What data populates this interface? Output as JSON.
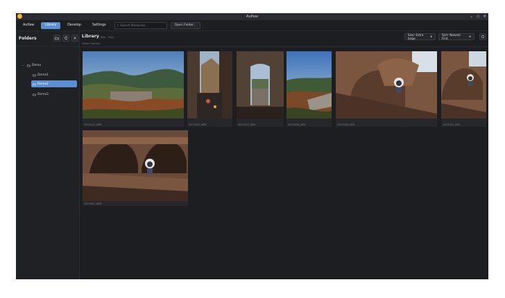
{
  "window": {
    "title": "Aulfaw",
    "controls": [
      "⌄",
      "◇",
      "✕"
    ]
  },
  "toolbar": {
    "app_name": "Aulfaw",
    "tabs": [
      "Library",
      "Develop",
      "Settings"
    ],
    "search_placeholder": "Search Memories...",
    "open_folder_label": "Open Folder..."
  },
  "sidebar": {
    "title": "Folders",
    "tree": {
      "root": "Demo",
      "children": [
        "Demo1",
        "Demo2",
        "Demo3"
      ],
      "selected": "Demo2"
    }
  },
  "library": {
    "title": "Library",
    "file_count": "7 files · Files",
    "folder_path": "Folder: Demo2",
    "thumbnail_size": "Size: Extra large",
    "sort": "Sort: Newest First",
    "images": [
      {
        "filename": "20210412_ARW",
        "scene": "valley-town"
      },
      {
        "filename": "20210420_ARW",
        "scene": "castle-street"
      },
      {
        "filename": "20210417_ARW",
        "scene": "stone-window"
      },
      {
        "filename": "20210418_ARW",
        "scene": "castle-view"
      },
      {
        "filename": "20210408_ARW",
        "scene": "arches-figure"
      },
      {
        "filename": "20210405_ARW",
        "scene": "arches-figure-2"
      },
      {
        "filename": "20210402_ARW",
        "scene": "arches-figure-3"
      }
    ]
  },
  "colors": {
    "accent": "#5a8fd1",
    "background": "#1c1e22",
    "sidebar": "#1f2125",
    "app_icon": "#f5b82e"
  }
}
